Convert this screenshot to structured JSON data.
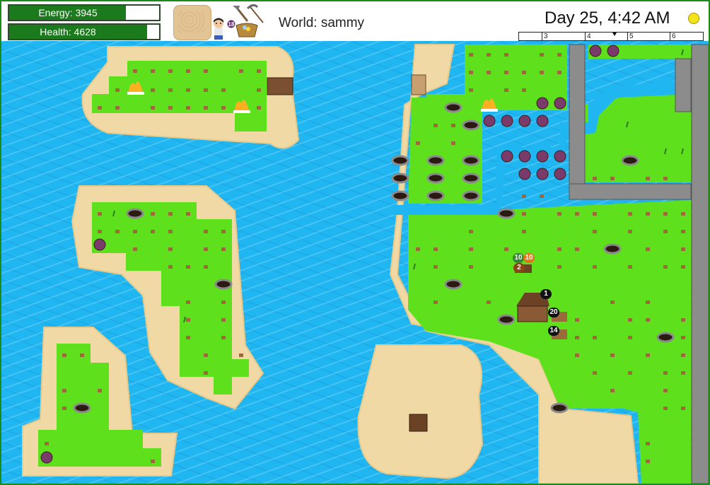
{
  "hud": {
    "energy_label": "Energy: 3945",
    "health_label": "Health: 4628",
    "energy_pct": 78,
    "health_pct": 92,
    "inventory_badge": "18",
    "world_label": "World: sammy",
    "day_time": "Day 25, 4:42 AM",
    "timeline_ticks": [
      "3",
      "4",
      "5",
      "6"
    ]
  },
  "map": {
    "badges": [
      {
        "id": "badge-10-green",
        "text": "10",
        "color": "#2e8b2e"
      },
      {
        "id": "badge-10-orange",
        "text": "10",
        "color": "#e07818"
      },
      {
        "id": "badge-2",
        "text": "2",
        "color": "#8b4513"
      },
      {
        "id": "badge-1",
        "text": "1",
        "color": "#111111"
      },
      {
        "id": "badge-20",
        "text": "20",
        "color": "#111111"
      },
      {
        "id": "badge-14",
        "text": "14",
        "color": "#111111"
      }
    ]
  },
  "colors": {
    "water": "#1fb6f1",
    "sand": "#f0d9a4",
    "grass": "#5fe01c",
    "rock": "#8c8c8c",
    "bar_fill": "#1b7a1b"
  }
}
